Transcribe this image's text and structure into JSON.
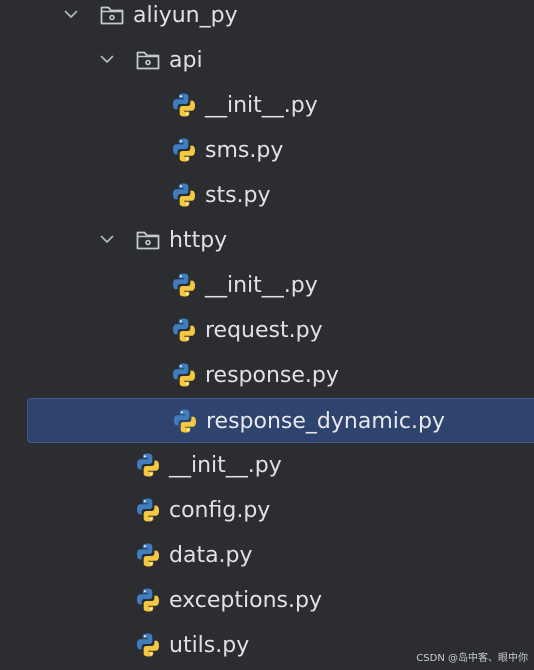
{
  "tree": {
    "rows": [
      {
        "label": "aliyun_py",
        "type": "folder",
        "depth": 0,
        "expanded": true,
        "selected": false
      },
      {
        "label": "api",
        "type": "folder",
        "depth": 1,
        "expanded": true,
        "selected": false
      },
      {
        "label": "__init__.py",
        "type": "python-file",
        "depth": 2,
        "selected": false
      },
      {
        "label": "sms.py",
        "type": "python-file",
        "depth": 2,
        "selected": false
      },
      {
        "label": "sts.py",
        "type": "python-file",
        "depth": 2,
        "selected": false
      },
      {
        "label": "httpy",
        "type": "folder",
        "depth": 1,
        "expanded": true,
        "selected": false
      },
      {
        "label": "__init__.py",
        "type": "python-file",
        "depth": 2,
        "selected": false
      },
      {
        "label": "request.py",
        "type": "python-file",
        "depth": 2,
        "selected": false
      },
      {
        "label": "response.py",
        "type": "python-file",
        "depth": 2,
        "selected": false
      },
      {
        "label": "response_dynamic.py",
        "type": "python-file",
        "depth": 2,
        "selected": true
      },
      {
        "label": "__init__.py",
        "type": "python-file",
        "depth": 1,
        "selected": false
      },
      {
        "label": "config.py",
        "type": "python-file",
        "depth": 1,
        "selected": false
      },
      {
        "label": "data.py",
        "type": "python-file",
        "depth": 1,
        "selected": false
      },
      {
        "label": "exceptions.py",
        "type": "python-file",
        "depth": 1,
        "selected": false
      },
      {
        "label": "utils.py",
        "type": "python-file",
        "depth": 1,
        "selected": false
      }
    ]
  },
  "watermark": "CSDN @岛中客、眼中你",
  "colors": {
    "background": "#2b2d30",
    "selection": "#2e436e",
    "text": "#dfe1e5",
    "python_blue": "#3f7cc0",
    "python_yellow": "#f5c842"
  },
  "icons": {
    "folder": "folder-icon",
    "python-file": "python-file-icon",
    "chevron": "chevron-down-icon"
  }
}
